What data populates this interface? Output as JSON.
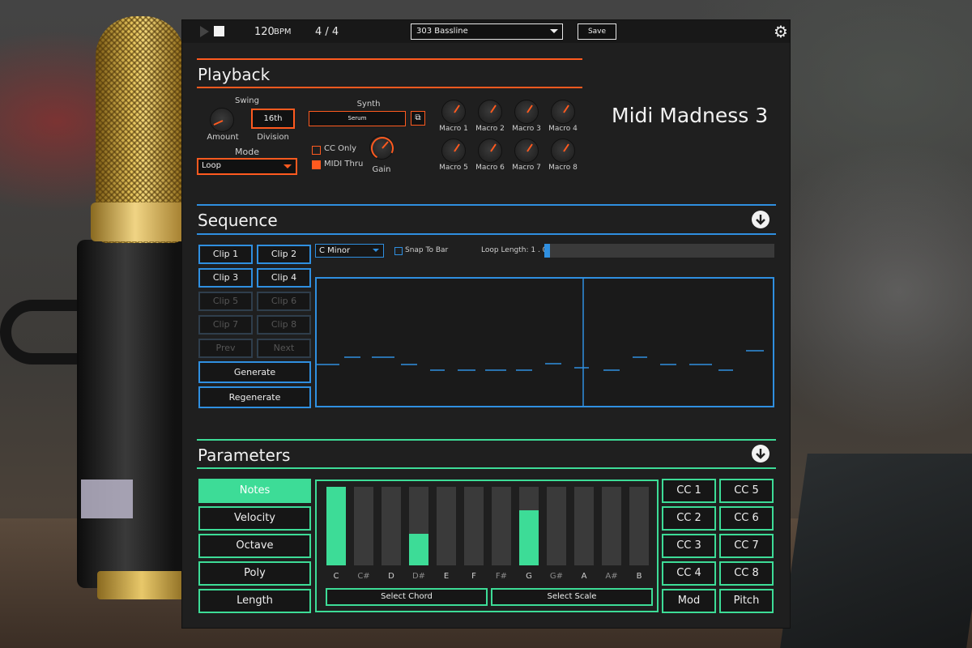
{
  "transport": {
    "bpm": "120",
    "bpm_unit": "BPM",
    "time_signature": "4 / 4",
    "preset": "303 Bassline",
    "save_label": "Save"
  },
  "playback": {
    "title": "Playback",
    "swing_label": "Swing",
    "amount_label": "Amount",
    "division_value": "16th",
    "division_label": "Division",
    "mode_label": "Mode",
    "mode_value": "Loop",
    "synth_label": "Synth",
    "synth_value": "Serum",
    "cc_only_label": "CC Only",
    "midi_thru_label": "MIDI Thru",
    "gain_label": "Gain",
    "macros": [
      "Macro 1",
      "Macro 2",
      "Macro 3",
      "Macro 4",
      "Macro 5",
      "Macro 6",
      "Macro 7",
      "Macro 8"
    ],
    "app_title": "Midi Madness 3"
  },
  "sequence": {
    "title": "Sequence",
    "clips": [
      "Clip 1",
      "Clip 2",
      "Clip 3",
      "Clip 4",
      "Clip 5",
      "Clip 6",
      "Clip 7",
      "Clip 8"
    ],
    "prev_label": "Prev",
    "next_label": "Next",
    "generate_label": "Generate",
    "regenerate_label": "Regenerate",
    "scale_value": "C Minor",
    "snap_label": "Snap To Bar",
    "loop_length_label": "Loop Length: 1 . 0"
  },
  "parameters": {
    "title": "Parameters",
    "tabs": [
      "Notes",
      "Velocity",
      "Octave",
      "Poly",
      "Length"
    ],
    "notes": [
      "C",
      "C#",
      "D",
      "D#",
      "E",
      "F",
      "F#",
      "G",
      "G#",
      "A",
      "A#",
      "B"
    ],
    "note_levels": [
      1.0,
      0,
      0,
      0.4,
      0,
      0,
      0,
      0.7,
      0,
      0,
      0,
      0
    ],
    "select_chord_label": "Select Chord",
    "select_scale_label": "Select Scale",
    "cc_buttons": [
      "CC 1",
      "CC 5",
      "CC 2",
      "CC 6",
      "CC 3",
      "CC 7",
      "CC 4",
      "CC 8",
      "Mod",
      "Pitch"
    ]
  },
  "colors": {
    "playback_accent": "#ff5a1f",
    "sequence_accent": "#2f8fe0",
    "parameters_accent": "#3ddc97"
  }
}
